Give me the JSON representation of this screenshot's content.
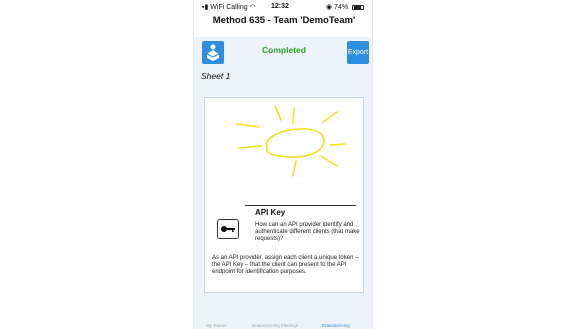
{
  "status_bar": {
    "carrier": "WiFi Calling",
    "time": "12:32",
    "battery": "74%"
  },
  "nav": {
    "title": "Method 635 - Team 'DemoTeam'"
  },
  "toolbar": {
    "status": "Completed",
    "export_label": "Export",
    "status_color": "#2aa12a",
    "accent": "#2e8fe0"
  },
  "sheet": {
    "label": "Sheet 1"
  },
  "card": {
    "title": "API Key",
    "problem": "How can an API provider identify and authenticate different clients (that make requests)?",
    "solution": "As an API provider, assign each client a unique token – the API Key – that the client can present to the API endpoint for identification purposes.",
    "icon": "key-icon",
    "sketch_color": "#f1e11a"
  },
  "tabs": [
    {
      "label": "My Teams",
      "active": false
    },
    {
      "label": "Brainstorming Findings",
      "active": false
    },
    {
      "label": "Brainstorming",
      "active": true
    }
  ]
}
